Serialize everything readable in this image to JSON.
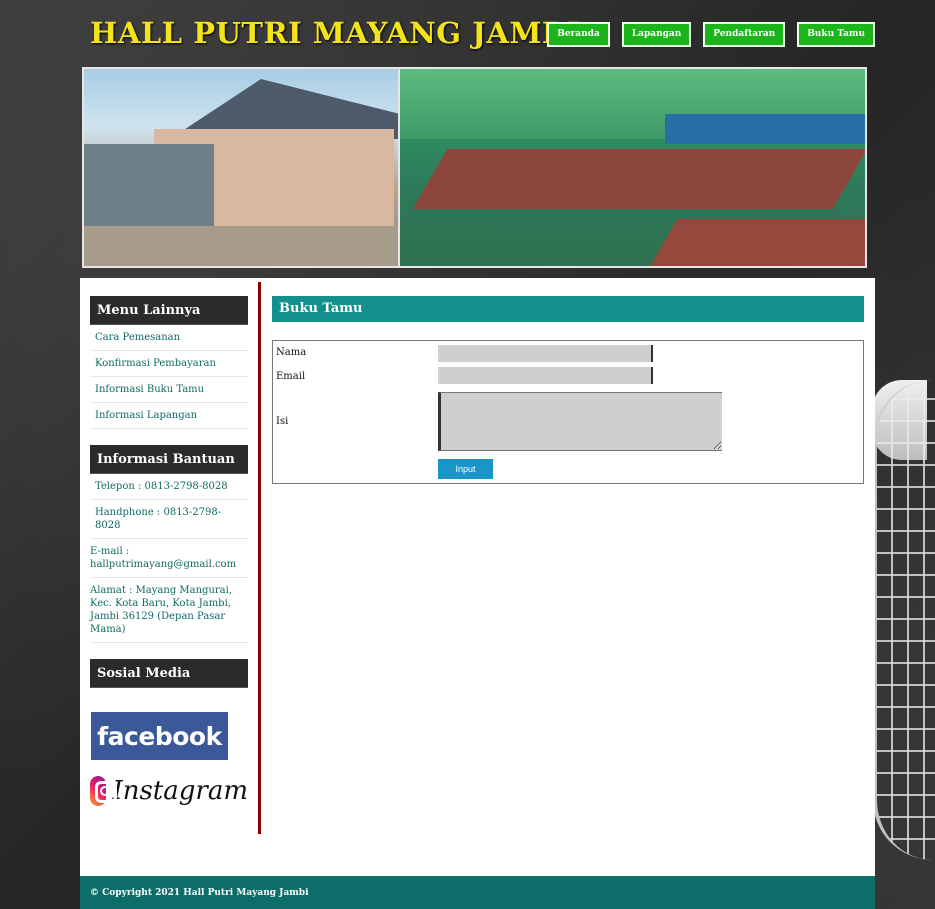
{
  "header": {
    "site_title": "HALL PUTRI MAYANG JAMBI",
    "nav": [
      "Beranda",
      "Lapangan",
      "Pendaftaran",
      "Buku Tamu"
    ]
  },
  "sidebar": {
    "menu_title": "Menu Lainnya",
    "menu_items": [
      "Cara Pemesanan",
      "Konfirmasi Pembayaran",
      "Informasi Buku Tamu",
      "Informasi Lapangan"
    ],
    "info_title": "Informasi Bantuan",
    "info_items": [
      "Telepon : 0813-2798-8028",
      "Handphone : 0813-2798-8028",
      "E-mail : hallputrimayang@gmail.com",
      "Alamat : Mayang Mangurai, Kec. Kota Baru, Kota Jambi, Jambi 36129 (Depan Pasar Mama)"
    ],
    "social_title": "Sosial Media",
    "facebook": "facebook",
    "instagram": "Instagram"
  },
  "main": {
    "title": "Buku Tamu",
    "form": {
      "nama_label": "Nama",
      "email_label": "Email",
      "isi_label": "Isi",
      "nama_value": "",
      "email_value": "",
      "isi_value": "",
      "submit_label": "Input"
    }
  },
  "footer": {
    "copyright": "© Copyright 2021 Hall Putri Mayang Jambi"
  },
  "colors": {
    "title_yellow": "#f2e31a",
    "nav_green": "#1bb51b",
    "teal": "#138f8e",
    "footer_teal": "#0d6d68",
    "divider_red": "#8a0000",
    "button_blue": "#1996c8"
  }
}
